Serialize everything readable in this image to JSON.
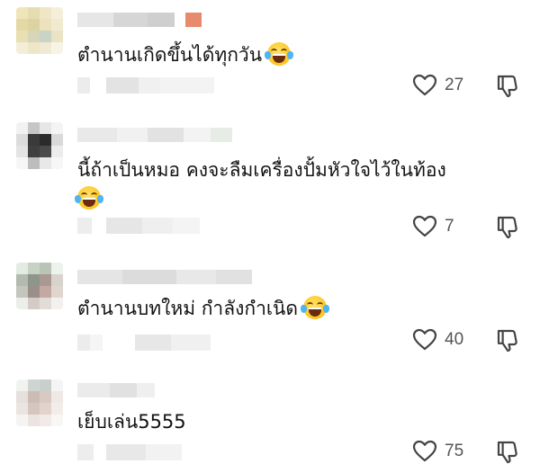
{
  "comments": [
    {
      "text": "ตำนานเกิดขึ้นได้ทุกวัน",
      "emoji": "face-with-tears-of-joy-icon",
      "likes": "27"
    },
    {
      "text_line1": "นี้ถ้าเป็นหมอ คงจะลืมเครื่องปั้มหัวใจไว้ในท้อง",
      "emoji": "face-with-tears-of-joy-icon",
      "likes": "7"
    },
    {
      "text": "ตำนานบทใหม่ กำลังกำเนิด",
      "emoji": "face-with-tears-of-joy-icon",
      "likes": "40"
    },
    {
      "text": "เย็บเล่น5555",
      "likes": "75"
    }
  ],
  "colors": {
    "text": "#121212",
    "count": "#555555",
    "icon": "#444444"
  }
}
